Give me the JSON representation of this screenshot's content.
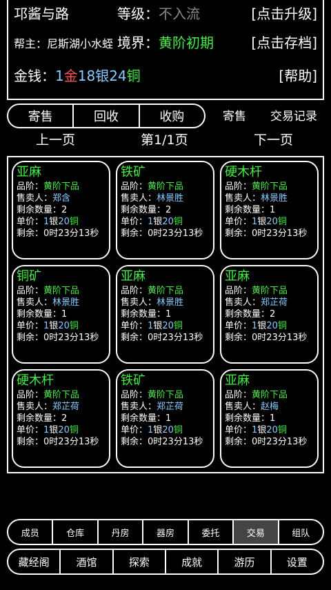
{
  "header": {
    "name": "邛酱与路",
    "level_label": "等级：",
    "level_value": "不入流",
    "upgrade_button": "[点击升级]",
    "gang_label": "帮主：",
    "gang_value": "尼斯湖小水蛭",
    "realm_label": "境界：",
    "realm_value": "黄阶初期",
    "save_button": "[点击存档]",
    "money_label": "金钱：",
    "gold_num": "1",
    "gold_unit": "金",
    "silver_num": "18",
    "silver_unit": "银",
    "copper_num": "24",
    "copper_unit": "铜",
    "help_button": "[帮助]"
  },
  "tabs": [
    "寄售",
    "回收",
    "收购"
  ],
  "side_buttons": {
    "consign": "寄售",
    "records": "交易记录"
  },
  "pager": {
    "prev": "上一页",
    "page": "第1/1页",
    "next": "下一页"
  },
  "labels": {
    "grade": "品阶：",
    "seller": "售卖人：",
    "qty": "剩余数量：",
    "price": "单价：",
    "remain": "剩余："
  },
  "items": [
    {
      "name": "亚麻",
      "grade": "黄阶下品",
      "seller": "郑含",
      "qty": "2",
      "p1": "1",
      "u1": "银",
      "p2": "20",
      "u2": "铜",
      "time": "0时23分13秒"
    },
    {
      "name": "铁矿",
      "grade": "黄阶下品",
      "seller": "林景胜",
      "qty": "2",
      "p1": "1",
      "u1": "银",
      "p2": "20",
      "u2": "铜",
      "time": "0时23分13秒"
    },
    {
      "name": "硬木杆",
      "grade": "黄阶下品",
      "seller": "林景胜",
      "qty": "1",
      "p1": "1",
      "u1": "银",
      "p2": "20",
      "u2": "铜",
      "time": "0时23分13秒"
    },
    {
      "name": "铜矿",
      "grade": "黄阶下品",
      "seller": "林景胜",
      "qty": "1",
      "p1": "1",
      "u1": "银",
      "p2": "20",
      "u2": "铜",
      "time": "0时23分13秒"
    },
    {
      "name": "亚麻",
      "grade": "黄阶下品",
      "seller": "林景胜",
      "qty": "1",
      "p1": "1",
      "u1": "银",
      "p2": "20",
      "u2": "铜",
      "time": "0时23分13秒"
    },
    {
      "name": "亚麻",
      "grade": "黄阶下品",
      "seller": "郑芷荷",
      "qty": "2",
      "p1": "1",
      "u1": "银",
      "p2": "20",
      "u2": "铜",
      "time": "0时23分13秒"
    },
    {
      "name": "硬木杆",
      "grade": "黄阶下品",
      "seller": "郑芷荷",
      "qty": "2",
      "p1": "1",
      "u1": "银",
      "p2": "20",
      "u2": "铜",
      "time": "0时23分13秒"
    },
    {
      "name": "铁矿",
      "grade": "黄阶下品",
      "seller": "郑芷荷",
      "qty": "1",
      "p1": "1",
      "u1": "银",
      "p2": "20",
      "u2": "铜",
      "time": "0时23分13秒"
    },
    {
      "name": "亚麻",
      "grade": "黄阶下品",
      "seller": "赵梅",
      "qty": "1",
      "p1": "1",
      "u1": "银",
      "p2": "20",
      "u2": "铜",
      "time": "0时23分13秒"
    }
  ],
  "nav_top": [
    "成员",
    "仓库",
    "丹房",
    "器房",
    "委托",
    "交易",
    "组队"
  ],
  "nav_top_active": "交易",
  "nav_bottom": [
    "藏经阁",
    "酒馆",
    "探索",
    "成就",
    "游历",
    "设置"
  ],
  "colors": {
    "green": "#44ee44",
    "blue": "#88ccff",
    "gray": "#888888",
    "gold": "#ff5555"
  }
}
